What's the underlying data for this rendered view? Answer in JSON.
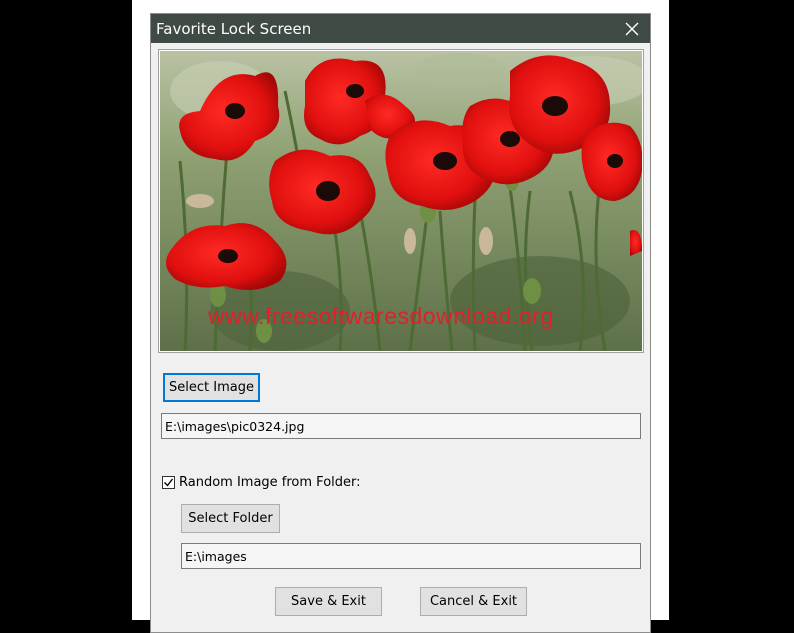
{
  "window": {
    "title": "Favorite Lock Screen",
    "close_icon": "close-icon"
  },
  "preview": {
    "watermark": "www.freesoftwaresdownload.org",
    "description_icon": "poppy-photo"
  },
  "select_image": {
    "button_label": "Select Image",
    "path_value": "E:\\images\\pic0324.jpg"
  },
  "random_folder": {
    "checkbox_label": "Random Image from Folder:",
    "checked": true,
    "button_label": "Select Folder",
    "path_value": "E:\\images"
  },
  "footer": {
    "save_label": "Save & Exit",
    "cancel_label": "Cancel & Exit"
  },
  "colors": {
    "titlebar": "#3f4a45",
    "focus": "#0078d7",
    "watermark": "#e0202a"
  }
}
